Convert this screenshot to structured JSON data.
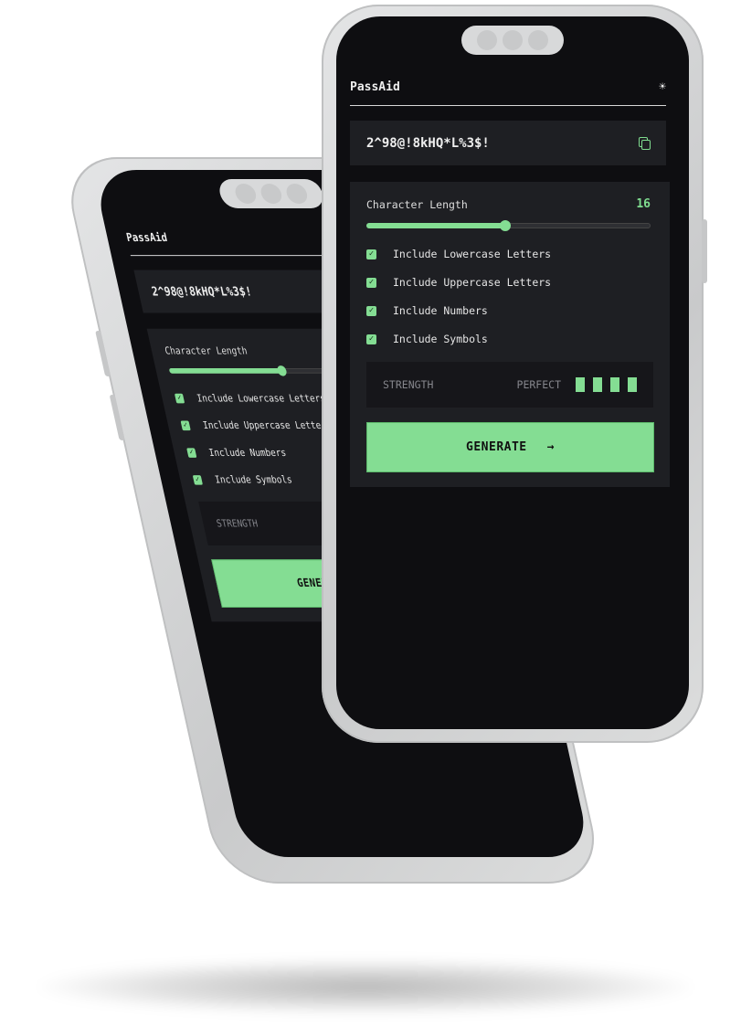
{
  "app": {
    "title": "PassAid",
    "theme_icon": "sun-icon"
  },
  "password": {
    "value": "2^98@!8kHQ*L%3$!",
    "copy_icon": "copy-icon"
  },
  "settings": {
    "length_label": "Character Length",
    "length_value": "16",
    "slider_fraction": 0.49,
    "options": [
      {
        "label": "Include Lowercase Letters",
        "checked": true
      },
      {
        "label": "Include Uppercase Letters",
        "checked": true
      },
      {
        "label": "Include Numbers",
        "checked": true
      },
      {
        "label": "Include Symbols",
        "checked": true
      }
    ]
  },
  "strength": {
    "label": "STRENGTH",
    "value": "PERFECT",
    "bars_filled": 4,
    "bars_total": 4
  },
  "generate": {
    "label": "GENERATE",
    "icon": "arrow-right-icon"
  },
  "colors": {
    "accent": "#84dd93",
    "background": "#0e0e11",
    "card": "#1e1f23"
  }
}
